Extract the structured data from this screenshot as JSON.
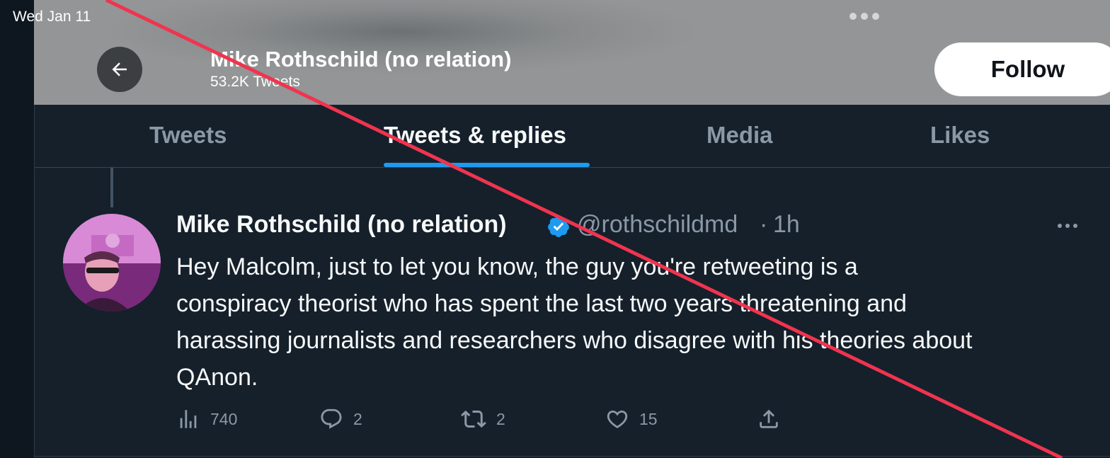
{
  "status_bar": {
    "time": "Wed Jan 11"
  },
  "header": {
    "name": "Mike Rothschild (no relation)",
    "tweet_count": "53.2K Tweets",
    "follow_label": "Follow"
  },
  "tabs": [
    {
      "label": "Tweets",
      "active": false
    },
    {
      "label": "Tweets & replies",
      "active": true
    },
    {
      "label": "Media",
      "active": false
    },
    {
      "label": "Likes",
      "active": false
    }
  ],
  "tweet": {
    "author_name": "Mike Rothschild (no relation)",
    "handle": "@rothschildmd",
    "separator": "·",
    "time": "1h",
    "text_lines": [
      "Hey Malcolm, just to let you know, the guy you're retweeting is a",
      "conspiracy theorist who has spent the last two years threatening and",
      "harassing journalists and researchers who disagree with his theories about",
      "QAnon."
    ],
    "stats": {
      "views": "740",
      "replies": "2",
      "retweets": "2",
      "likes": "15"
    }
  },
  "colors": {
    "background": "#15202b",
    "accent": "#1d9bf0",
    "muted_text": "#8b98a5",
    "strike_line": "#f0344f"
  },
  "icons": [
    "back-arrow-icon",
    "verified-badge-icon",
    "more-icon",
    "views-icon",
    "reply-icon",
    "retweet-icon",
    "like-icon",
    "share-icon"
  ]
}
